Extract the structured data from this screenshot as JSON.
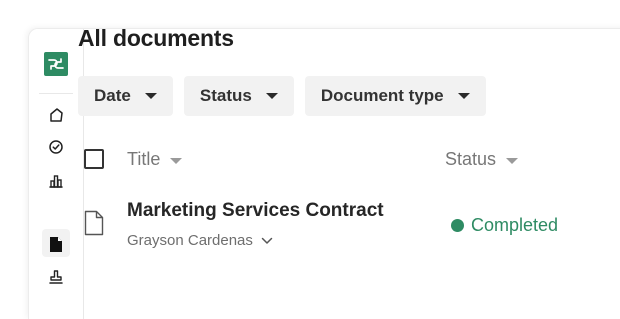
{
  "page": {
    "title": "All documents"
  },
  "sidebar": {
    "logo": "pandadoc-logo",
    "items": [
      {
        "name": "sidebar-item-home",
        "icon": "home-icon"
      },
      {
        "name": "sidebar-item-tasks",
        "icon": "check-circle-icon"
      },
      {
        "name": "sidebar-item-reports",
        "icon": "bar-chart-icon"
      },
      {
        "name": "sidebar-item-documents",
        "icon": "document-icon",
        "active": true
      },
      {
        "name": "sidebar-item-stamp",
        "icon": "stamp-icon"
      }
    ]
  },
  "filters": [
    {
      "label": "Date"
    },
    {
      "label": "Status"
    },
    {
      "label": "Document type"
    }
  ],
  "table": {
    "columns": {
      "title": "Title",
      "status": "Status"
    },
    "rows": [
      {
        "title": "Marketing Services Contract",
        "owner": "Grayson Cardenas",
        "status": "Completed",
        "status_color": "#2e8b63"
      }
    ]
  },
  "colors": {
    "brand": "#2e8b63"
  }
}
